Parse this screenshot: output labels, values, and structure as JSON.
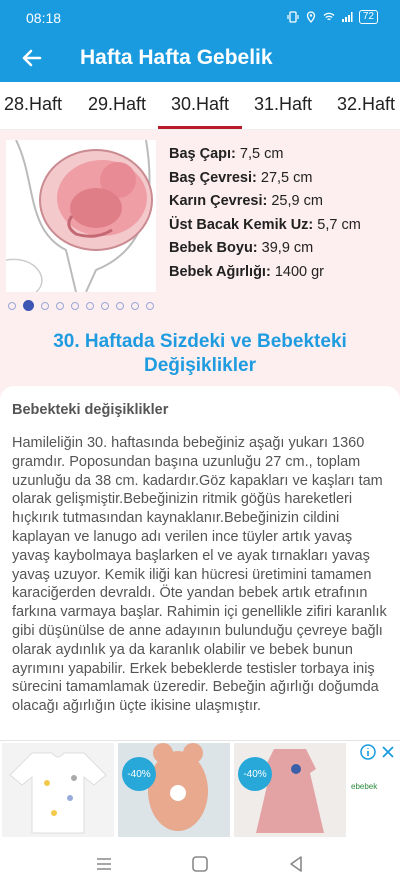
{
  "status": {
    "time": "08:18",
    "battery": "72"
  },
  "appbar": {
    "title": "Hafta Hafta Gebelik"
  },
  "tabs": [
    {
      "label": "28.Haft"
    },
    {
      "label": "29.Haft"
    },
    {
      "label": "30.Haft",
      "selected": true
    },
    {
      "label": "31.Haft"
    },
    {
      "label": "32.Haft"
    }
  ],
  "facts": [
    {
      "label": "Baş Çapı:",
      "value": " 7,5 cm"
    },
    {
      "label": "Baş Çevresi:",
      "value": " 27,5 cm"
    },
    {
      "label": "Karın Çevresi:",
      "value": " 25,9 cm"
    },
    {
      "label": "Üst Bacak Kemik Uz:",
      "value": " 5,7 cm"
    },
    {
      "label": "Bebek Boyu:",
      "value": " 39,9 cm"
    },
    {
      "label": "Bebek Ağırlığı:",
      "value": " 1400 gr"
    }
  ],
  "pager": {
    "active_index": 1,
    "count": 10
  },
  "heading": {
    "line1": "30. Haftada Sizdeki ve Bebekteki",
    "line2": "Değişiklikler"
  },
  "card": {
    "subtitle": "Bebekteki değişiklikler",
    "body": "Hamileliğin 30. haftasında bebeğiniz aşağı yukarı 1360 gramdır. Poposundan başına uzunluğu 27 cm., toplam uzunluğu da 38 cm. kadardır.Göz kapakları ve kaşları tam olarak gelişmiştir.Bebeğinizin ritmik göğüs hareketleri hıçkırık tutmasından kaynaklanır.Bebeğinizin cildini kaplayan ve lanugo adı verilen ince tüyler artık yavaş yavaş kaybolmaya başlarken el ve ayak tırnakları yavaş yavaş uzuyor. Kemik iliği kan hücresi üretimini tamamen karaciğerden devraldı. Öte yandan bebek artık etrafının farkına varmaya başlar. Rahimin içi genellikle zifiri karanlık gibi düşünülse de anne adayının bulunduğu çevreye bağlı olarak aydınlık ya da karanlık olabilir ve bebek bunun ayrımını yapabilir. Erkek bebeklerde testisler torbaya iniş sürecini tamamlamak üzeredir. Bebeğin ağırlığı doğumda olacağı ağırlığın üçte ikisine ulaşmıştır."
  },
  "ad": {
    "products": [
      {
        "badge": ""
      },
      {
        "badge": "-40%"
      },
      {
        "badge": "-40%"
      }
    ],
    "brand": "ebebek"
  },
  "colors": {
    "primary": "#1a9be0",
    "tab_indicator": "#b91b2a",
    "heading": "#1f9ce0",
    "background": "#fdeef0"
  }
}
